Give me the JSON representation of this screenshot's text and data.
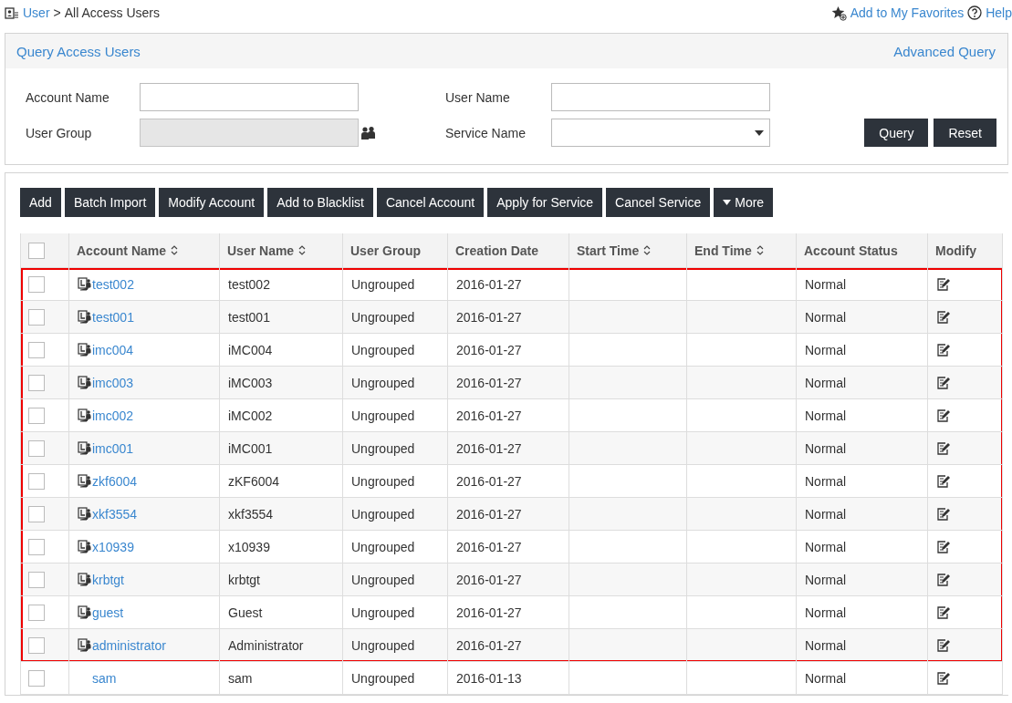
{
  "breadcrumb": {
    "parent": "User",
    "separator": ">",
    "current": "All Access Users"
  },
  "header_links": [
    "Add to My Favorites",
    "Help"
  ],
  "query_panel": {
    "title": "Query Access Users",
    "advanced_link": "Advanced Query",
    "fields": [
      {
        "label": "Account Name",
        "kind": "text",
        "disabled": false
      },
      {
        "label": "User Name",
        "kind": "text",
        "disabled": false
      },
      {
        "label": "User Group",
        "kind": "picker",
        "disabled": true
      },
      {
        "label": "Service Name",
        "kind": "select",
        "disabled": false
      }
    ],
    "buttons": [
      "Query",
      "Reset"
    ]
  },
  "toolbar": [
    {
      "label": "Add",
      "kind": "plain"
    },
    {
      "label": "Batch Import",
      "kind": "plain"
    },
    {
      "label": "Modify Account",
      "kind": "plain"
    },
    {
      "label": "Add to Blacklist",
      "kind": "plain"
    },
    {
      "label": "Cancel Account",
      "kind": "plain"
    },
    {
      "label": "Apply for Service",
      "kind": "plain"
    },
    {
      "label": "Cancel Service",
      "kind": "plain"
    },
    {
      "label": "More",
      "kind": "menu"
    }
  ],
  "table": {
    "header_checked": false,
    "columns": [
      {
        "label": "Account Name",
        "sortable": true
      },
      {
        "label": "User Name",
        "sortable": true
      },
      {
        "label": "User Group",
        "sortable": false
      },
      {
        "label": "Creation Date",
        "sortable": false
      },
      {
        "label": "Start Time",
        "sortable": true
      },
      {
        "label": "End Time",
        "sortable": true
      },
      {
        "label": "Account Status",
        "sortable": false
      },
      {
        "label": "Modify",
        "sortable": false
      }
    ],
    "rows": [
      {
        "account": "test002",
        "user": "test002",
        "group": "Ungrouped",
        "created": "2016-01-27",
        "status": "Normal",
        "ldap": true,
        "highlighted": true,
        "checked": false
      },
      {
        "account": "test001",
        "user": "test001",
        "group": "Ungrouped",
        "created": "2016-01-27",
        "status": "Normal",
        "ldap": true,
        "highlighted": true,
        "checked": false
      },
      {
        "account": "imc004",
        "user": "iMC004",
        "group": "Ungrouped",
        "created": "2016-01-27",
        "status": "Normal",
        "ldap": true,
        "highlighted": true,
        "checked": false
      },
      {
        "account": "imc003",
        "user": "iMC003",
        "group": "Ungrouped",
        "created": "2016-01-27",
        "status": "Normal",
        "ldap": true,
        "highlighted": true,
        "checked": false
      },
      {
        "account": "imc002",
        "user": "iMC002",
        "group": "Ungrouped",
        "created": "2016-01-27",
        "status": "Normal",
        "ldap": true,
        "highlighted": true,
        "checked": false
      },
      {
        "account": "imc001",
        "user": "iMC001",
        "group": "Ungrouped",
        "created": "2016-01-27",
        "status": "Normal",
        "ldap": true,
        "highlighted": true,
        "checked": false
      },
      {
        "account": "zkf6004",
        "user": "zKF6004",
        "group": "Ungrouped",
        "created": "2016-01-27",
        "status": "Normal",
        "ldap": true,
        "highlighted": true,
        "checked": false
      },
      {
        "account": "xkf3554",
        "user": "xkf3554",
        "group": "Ungrouped",
        "created": "2016-01-27",
        "status": "Normal",
        "ldap": true,
        "highlighted": true,
        "checked": false
      },
      {
        "account": "x10939",
        "user": "x10939",
        "group": "Ungrouped",
        "created": "2016-01-27",
        "status": "Normal",
        "ldap": true,
        "highlighted": true,
        "checked": false
      },
      {
        "account": "krbtgt",
        "user": "krbtgt",
        "group": "Ungrouped",
        "created": "2016-01-27",
        "status": "Normal",
        "ldap": true,
        "highlighted": true,
        "checked": false
      },
      {
        "account": "guest",
        "user": "Guest",
        "group": "Ungrouped",
        "created": "2016-01-27",
        "status": "Normal",
        "ldap": true,
        "highlighted": true,
        "checked": false
      },
      {
        "account": "administrator",
        "user": "Administrator",
        "group": "Ungrouped",
        "created": "2016-01-27",
        "status": "Normal",
        "ldap": true,
        "highlighted": true,
        "checked": false
      },
      {
        "account": "sam",
        "user": "sam",
        "group": "Ungrouped",
        "created": "2016-01-13",
        "status": "Normal",
        "ldap": false,
        "highlighted": false,
        "checked": false
      }
    ]
  }
}
